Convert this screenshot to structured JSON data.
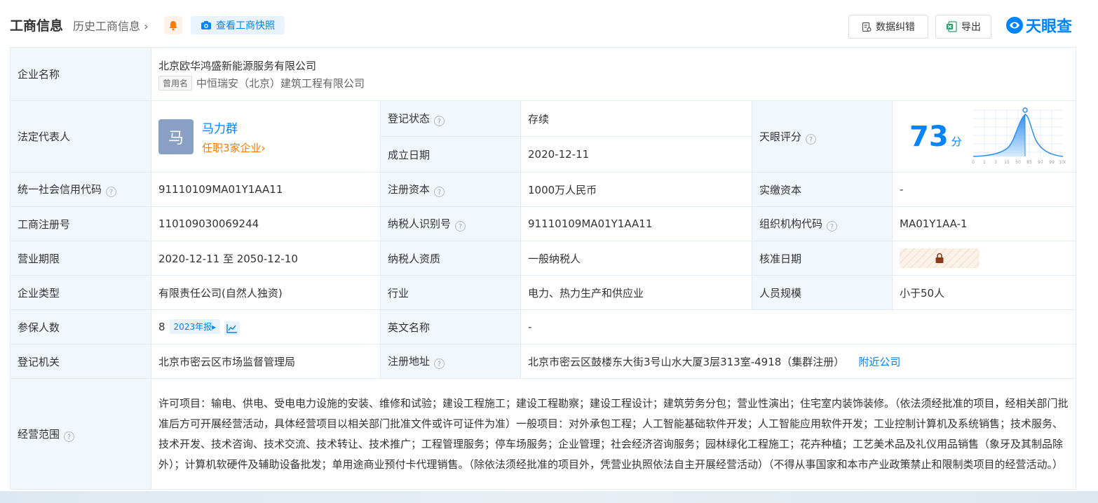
{
  "header": {
    "title": "工商信息",
    "history_link": "历史工商信息",
    "snapshot_btn": "查看工商快照",
    "correct_btn": "数据纠错",
    "export_btn": "导出",
    "logo_text": "天眼查",
    "accent": "#0084ff"
  },
  "rows": {
    "name_label": "企业名称",
    "name_value": "北京欧华鸿盛新能源服务有限公司",
    "used_name_tag": "曾用名",
    "used_name_value": "中恒瑞安（北京）建筑工程有限公司",
    "legal_label": "法定代表人",
    "legal_avatar": "马",
    "legal_name": "马力群",
    "legal_jobs": "任职3家企业",
    "status_label": "登记状态",
    "status_value": "存续",
    "founded_label": "成立日期",
    "founded_value": "2020-12-11",
    "score_label": "天眼评分",
    "score_value": "73",
    "score_unit": "分",
    "score_ticks": [
      "0",
      "1",
      "3",
      "15",
      "50",
      "85",
      "97",
      "99",
      "100"
    ],
    "credit_label": "统一社会信用代码",
    "credit_value": "91110109MA01Y1AA11",
    "capital_label": "注册资本",
    "capital_value": "1000万人民币",
    "paid_label": "实缴资本",
    "paid_value": "-",
    "regno_label": "工商注册号",
    "regno_value": "110109030069244",
    "taxid_label": "纳税人识别号",
    "taxid_value": "91110109MA01Y1AA11",
    "orgcode_label": "组织机构代码",
    "orgcode_value": "MA01Y1AA-1",
    "term_label": "营业期限",
    "term_value": "2020-12-11 至 2050-12-10",
    "taxqual_label": "纳税人资质",
    "taxqual_value": "一般纳税人",
    "approve_label": "核准日期",
    "type_label": "企业类型",
    "type_value": "有限责任公司(自然人独资)",
    "industry_label": "行业",
    "industry_value": "电力、热力生产和供应业",
    "staff_label": "人员规模",
    "staff_value": "小于50人",
    "insured_label": "参保人数",
    "insured_value": "8",
    "insured_year": "2023年报",
    "english_label": "英文名称",
    "english_value": "-",
    "authority_label": "登记机关",
    "authority_value": "北京市密云区市场监督管理局",
    "address_label": "注册地址",
    "address_value": "北京市密云区鼓楼东大街3号山水大厦3层313室-4918（集群注册）",
    "nearby_link": "附近公司",
    "scope_label": "经营范围",
    "scope_value": "许可项目：输电、供电、受电电力设施的安装、维修和试验；建设工程施工；建设工程勘察；建设工程设计；建筑劳务分包；营业性演出；住宅室内装饰装修。（依法须经批准的项目，经相关部门批准后方可开展经营活动，具体经营项目以相关部门批准文件或许可证件为准）一般项目：对外承包工程；人工智能基础软件开发；人工智能应用软件开发；工业控制计算机及系统销售；技术服务、技术开发、技术咨询、技术交流、技术转让、技术推广；工程管理服务；停车场服务；企业管理；社会经济咨询服务；园林绿化工程施工；花卉种植；工艺美术品及礼仪用品销售（象牙及其制品除外）；计算机软硬件及辅助设备批发；单用途商业预付卡代理销售。（除依法须经批准的项目外，凭营业执照依法自主开展经营活动）（不得从事国家和本市产业政策禁止和限制类项目的经营活动。）"
  }
}
